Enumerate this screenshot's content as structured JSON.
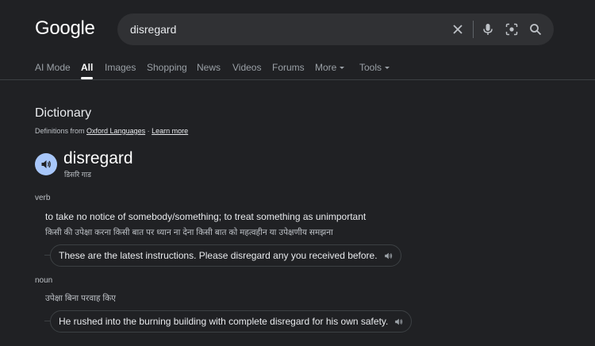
{
  "header": {
    "logo": "Google",
    "search": {
      "query": "disregard"
    }
  },
  "tabs": [
    {
      "label": "AI Mode"
    },
    {
      "label": "All",
      "active": true
    },
    {
      "label": "Images"
    },
    {
      "label": "Shopping"
    },
    {
      "label": "News"
    },
    {
      "label": "Videos"
    },
    {
      "label": "Forums"
    },
    {
      "label": "More"
    },
    {
      "label": "Tools"
    }
  ],
  "dictionary": {
    "title": "Dictionary",
    "source_prefix": "Definitions from",
    "source_link": "Oxford Languages",
    "separator": "·",
    "learn_more": "Learn more",
    "word": "disregard",
    "pronunciation": "डिसरि गाड",
    "entries": [
      {
        "pos": "verb",
        "definition": "to take no notice of somebody/something; to treat something as unimportant",
        "translation": "किसी की उपेक्षा करना किसी बात पर ध्यान ना देना किसी बात को महत्वहीन या उपेक्षणीय समझना",
        "example": "These are the latest instructions. Please disregard any you received before."
      },
      {
        "pos": "noun",
        "translation": "उपेक्षा बिना परवाह किए",
        "example": "He rushed into the burning building with complete disregard for his own safety."
      }
    ]
  },
  "colors": {
    "background": "#202124",
    "search_bg": "#303134",
    "speaker_bg": "#a8c7fa",
    "text_primary": "#e8eaed",
    "text_secondary": "#9aa0a6"
  },
  "icons": [
    "clear-icon",
    "mic-icon",
    "lens-icon",
    "search-icon",
    "speaker-icon"
  ]
}
